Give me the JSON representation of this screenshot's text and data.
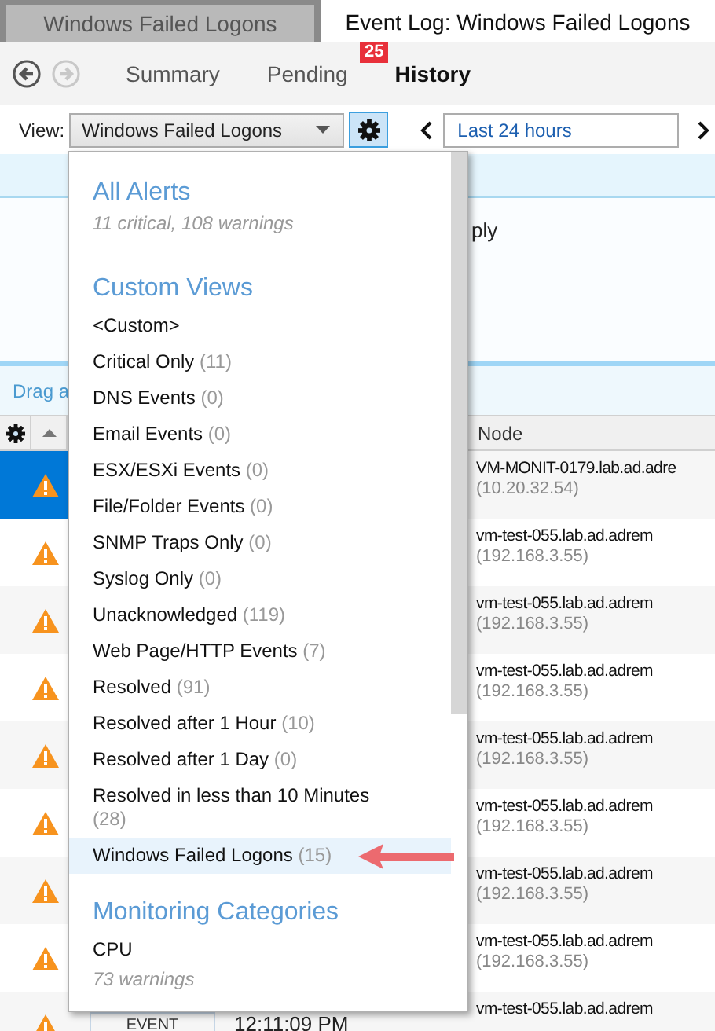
{
  "tabs": [
    {
      "label": "Windows Failed Logons",
      "selected": false
    },
    {
      "label": "Event Log: Windows Failed Logons",
      "selected": true
    }
  ],
  "history_buttons": [
    {
      "kind": "back",
      "disabled": false
    },
    {
      "kind": "forward",
      "disabled": true
    }
  ],
  "nav": [
    {
      "label": "Summary",
      "selected": false
    },
    {
      "label": "Pending",
      "selected": false,
      "badge": "25"
    },
    {
      "label": "History",
      "selected": true
    }
  ],
  "toolbar": {
    "view_label": "View:",
    "view_value": "Windows Failed Logons",
    "range": "Last 24 hours"
  },
  "background": {
    "text_fragment": "ply",
    "drag_hint": "Drag a"
  },
  "grid": {
    "column_label": "Node",
    "rows": [
      {
        "selected": true,
        "node": "VM-MONIT-0179.lab.ad.adre",
        "ip": "(10.20.32.54)"
      },
      {
        "selected": false,
        "node": "vm-test-055.lab.ad.adrem",
        "ip": "(192.168.3.55)"
      },
      {
        "selected": false,
        "node": "vm-test-055.lab.ad.adrem",
        "ip": "(192.168.3.55)"
      },
      {
        "selected": false,
        "node": "vm-test-055.lab.ad.adrem",
        "ip": "(192.168.3.55)"
      },
      {
        "selected": false,
        "node": "vm-test-055.lab.ad.adrem",
        "ip": "(192.168.3.55)"
      },
      {
        "selected": false,
        "node": "vm-test-055.lab.ad.adrem",
        "ip": "(192.168.3.55)"
      },
      {
        "selected": false,
        "node": "vm-test-055.lab.ad.adrem",
        "ip": "(192.168.3.55)"
      },
      {
        "selected": false,
        "node": "vm-test-055.lab.ad.adrem",
        "ip": "(192.168.3.55)"
      },
      {
        "selected": false,
        "node": "vm-test-055.lab.ad.adrem",
        "type": "EVENT",
        "time": "12:11:09 PM"
      }
    ]
  },
  "dropdown": [
    {
      "kind": "heading",
      "text": "All Alerts"
    },
    {
      "kind": "note",
      "text": "11 critical, 108 warnings"
    },
    {
      "kind": "heading",
      "text": "Custom Views"
    },
    {
      "kind": "item",
      "label": "<Custom>",
      "selected": false
    },
    {
      "kind": "item",
      "label": "Critical Only",
      "count": "(11)",
      "selected": false
    },
    {
      "kind": "item",
      "label": "DNS Events",
      "count": "(0)",
      "selected": false
    },
    {
      "kind": "item",
      "label": "Email Events",
      "count": "(0)",
      "selected": false
    },
    {
      "kind": "item",
      "label": "ESX/ESXi Events",
      "count": "(0)",
      "selected": false
    },
    {
      "kind": "item",
      "label": "File/Folder Events",
      "count": "(0)",
      "selected": false
    },
    {
      "kind": "item",
      "label": "SNMP Traps Only",
      "count": "(0)",
      "selected": false
    },
    {
      "kind": "item",
      "label": "Syslog Only",
      "count": "(0)",
      "selected": false
    },
    {
      "kind": "item",
      "label": "Unacknowledged",
      "count": "(119)",
      "selected": false
    },
    {
      "kind": "item",
      "label": "Web Page/HTTP Events",
      "count": "(7)",
      "selected": false
    },
    {
      "kind": "item",
      "label": "Resolved",
      "count": "(91)",
      "selected": false
    },
    {
      "kind": "item",
      "label": "Resolved after 1 Hour",
      "count": "(10)",
      "selected": false
    },
    {
      "kind": "item",
      "label": "Resolved after 1 Day",
      "count": "(0)",
      "selected": false
    },
    {
      "kind": "item",
      "label": "Resolved in less than 10 Minutes",
      "count": "(28)",
      "selected": false
    },
    {
      "kind": "item",
      "label": "Windows Failed Logons",
      "count": "(15)",
      "selected": true
    },
    {
      "kind": "heading",
      "text": "Monitoring Categories"
    },
    {
      "kind": "item",
      "label": "CPU",
      "selected": false
    },
    {
      "kind": "note",
      "text": "73 warnings"
    }
  ]
}
